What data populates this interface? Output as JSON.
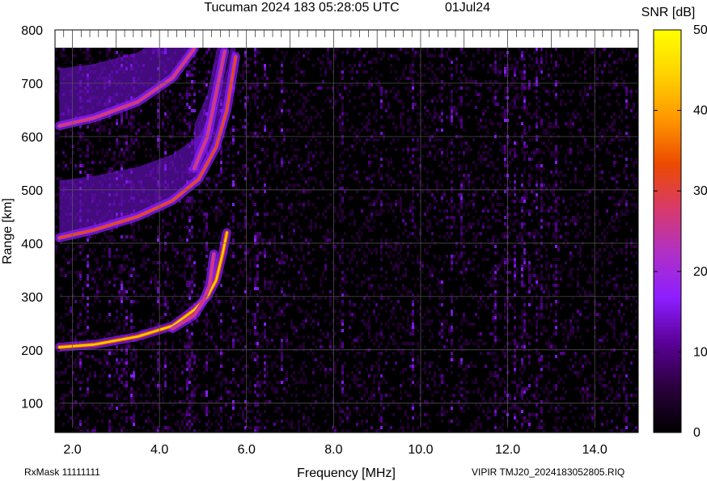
{
  "title": "Tucuman 2024 183 05:28:05 UTC",
  "date_label": "01Jul24",
  "footer_left": "RxMask 11111111",
  "footer_right": "VIPIR  TMJ20_2024183052805.RIQ",
  "colors": {
    "background": "#000000",
    "grid": "#5a5a5a",
    "colormap": [
      "#000000",
      "#2a003c",
      "#5a0096",
      "#8c1eff",
      "#b030c8",
      "#d83a6a",
      "#ec4a00",
      "#ff9600",
      "#ffd200",
      "#ffff00"
    ]
  },
  "chart_data": {
    "type": "heatmap",
    "title": "Tucuman 2024 183 05:28:05 UTC",
    "xlabel": "Frequency [MHz]",
    "ylabel": "Range [km]",
    "xlim": [
      1.6,
      15.0
    ],
    "ylim": [
      45,
      800
    ],
    "x_ticks": [
      "2.0",
      "4.0",
      "6.0",
      "8.0",
      "10.0",
      "12.0",
      "14.0"
    ],
    "y_ticks": [
      "100",
      "200",
      "300",
      "400",
      "500",
      "600",
      "700",
      "800"
    ],
    "colorbar": {
      "label": "SNR [dB]",
      "range": [
        0,
        50
      ],
      "ticks": [
        "0",
        "10",
        "20",
        "30",
        "40",
        "50"
      ]
    },
    "grid": true,
    "traces": [
      {
        "name": "1st hop trace",
        "freq_mhz": [
          1.7,
          2.5,
          3.5,
          4.3,
          4.8,
          5.1,
          5.3,
          5.45,
          5.55
        ],
        "range_km": [
          205,
          210,
          225,
          245,
          275,
          300,
          330,
          380,
          420
        ],
        "peak_snr_db": 45
      },
      {
        "name": "1st hop split trace",
        "freq_mhz": [
          4.3,
          4.8,
          5.0,
          5.15,
          5.25
        ],
        "range_km": [
          240,
          265,
          290,
          320,
          380
        ],
        "peak_snr_db": 30
      },
      {
        "name": "2nd hop trace",
        "freq_mhz": [
          1.7,
          2.5,
          3.5,
          4.3,
          4.9,
          5.3,
          5.55,
          5.75
        ],
        "range_km": [
          410,
          425,
          450,
          480,
          520,
          580,
          650,
          750
        ],
        "peak_snr_db": 32
      },
      {
        "name": "2nd hop split trace",
        "freq_mhz": [
          4.8,
          5.1,
          5.3,
          5.5
        ],
        "range_km": [
          540,
          600,
          680,
          760
        ],
        "peak_snr_db": 28
      },
      {
        "name": "3rd hop trace",
        "freq_mhz": [
          1.7,
          2.5,
          3.5,
          4.3,
          4.8
        ],
        "range_km": [
          620,
          635,
          665,
          710,
          765
        ],
        "peak_snr_db": 28
      }
    ]
  }
}
